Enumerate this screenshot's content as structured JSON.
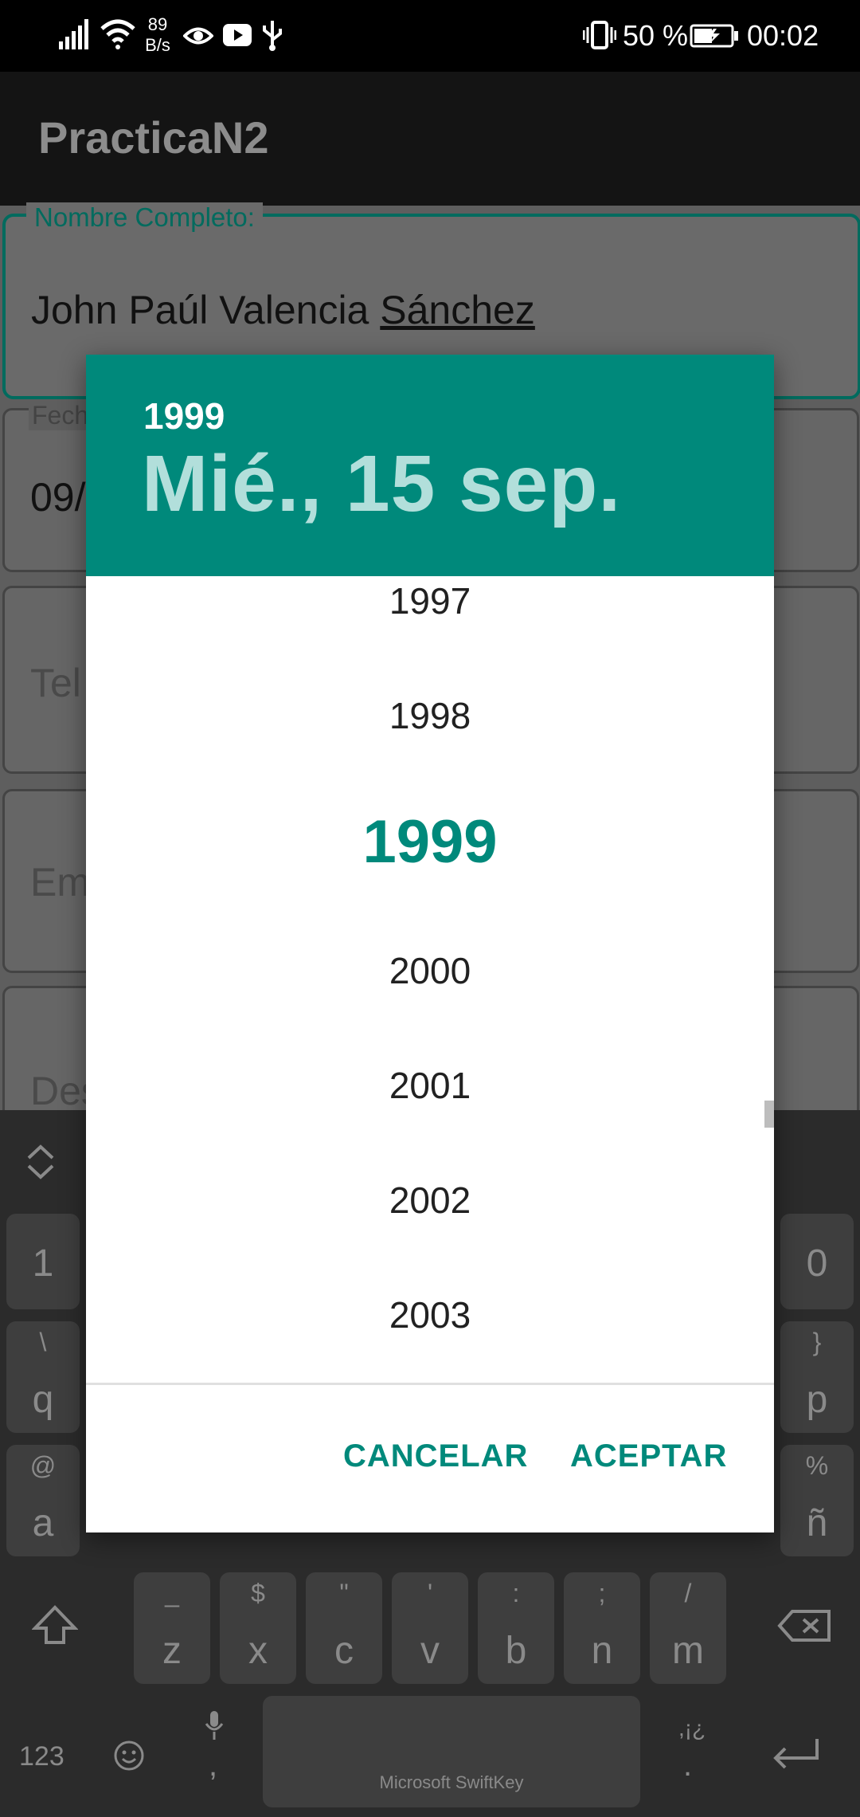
{
  "status_bar": {
    "net_speed_value": "89",
    "net_speed_unit": "B/s",
    "battery_percent": "50 %",
    "time": "00:02",
    "icons": [
      "signal-icon",
      "wifi-icon",
      "eye-icon",
      "youtube-icon",
      "usb-icon",
      "vibrate-icon",
      "battery-icon"
    ]
  },
  "app_bar": {
    "title": "PracticaN2"
  },
  "form": {
    "name_label": "Nombre Completo:",
    "name_value_plain": "John Paúl Valencia ",
    "name_value_underlined": "Sánchez",
    "date_label_partial": "Fech",
    "date_value_partial": "09/",
    "phone_hint_partial": "Tel",
    "email_hint_partial": "Em",
    "desc_hint_partial": "Des"
  },
  "keyboard": {
    "brand": "Microsoft SwiftKey",
    "left_number_key": "1",
    "right_number_key": "0",
    "row_q_left": {
      "main": "q",
      "alt": "\\"
    },
    "row_p_right": {
      "main": "p",
      "alt": "}"
    },
    "row_a_left": {
      "main": "a",
      "alt": "@"
    },
    "row_n_right": {
      "main": "ñ",
      "alt": "%"
    },
    "bottom_row": [
      {
        "main": "z",
        "alt": "_"
      },
      {
        "main": "x",
        "alt": "$"
      },
      {
        "main": "c",
        "alt": "\""
      },
      {
        "main": "v",
        "alt": "'"
      },
      {
        "main": "b",
        "alt": ":"
      },
      {
        "main": "n",
        "alt": ";"
      },
      {
        "main": "m",
        "alt": "/"
      }
    ],
    "num_toggle": "123",
    "comma": ",",
    "period": ".",
    "punct_alt": ",¡¿"
  },
  "dialog": {
    "header_year": "1999",
    "header_date": "Mié., 15 sep.",
    "years": [
      "1997",
      "1998",
      "1999",
      "2000",
      "2001",
      "2002",
      "2003"
    ],
    "selected_year": "1999",
    "cancel_label": "CANCELAR",
    "accept_label": "ACEPTAR",
    "accent_color": "#00897b"
  }
}
